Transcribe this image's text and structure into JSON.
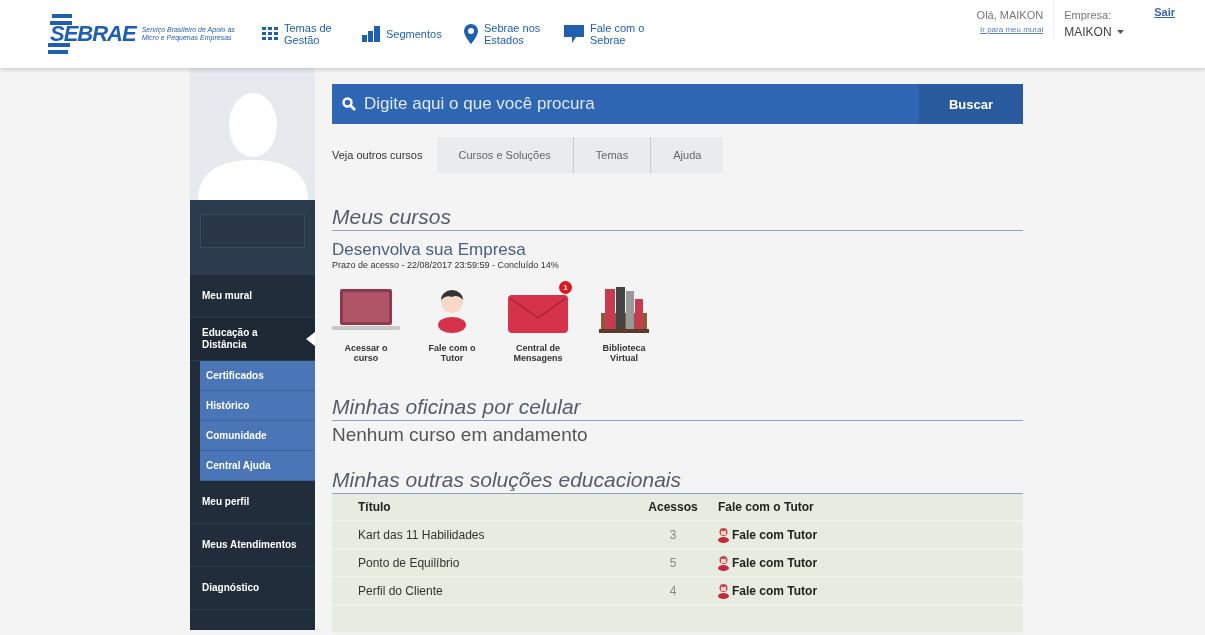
{
  "header": {
    "logo": {
      "name": "SEBRAE",
      "tagline": "Serviço Brasileiro de Apoio às Micro e Pequenas Empresas"
    },
    "nav": [
      {
        "kind": "grid",
        "label": "Temas de Gestão"
      },
      {
        "kind": "chart",
        "label": "Segmentos"
      },
      {
        "kind": "pin",
        "label": "Sebrae nos Estados"
      },
      {
        "kind": "chat",
        "label": "Fale com o Sebrae"
      }
    ],
    "user": {
      "greeting": "Olá, MAIKON",
      "link": "Ir para meu mural"
    },
    "company": {
      "label": "Empresa:",
      "value": "MAIKON"
    },
    "logout": "Sair"
  },
  "sidebar": {
    "items": [
      {
        "label": "Meu mural",
        "selected": false
      },
      {
        "label": "Educação a Distância",
        "selected": true,
        "expanded": true,
        "children": [
          {
            "label": "Certificados"
          },
          {
            "label": "Histórico"
          },
          {
            "label": "Comunidade"
          },
          {
            "label": "Central Ajuda"
          }
        ]
      },
      {
        "label": "Meu perfil",
        "selected": false
      },
      {
        "label": "Meus Atendimentos",
        "selected": false
      },
      {
        "label": "Diagnóstico",
        "selected": false
      }
    ]
  },
  "search": {
    "placeholder": "Digite aqui o que você procura",
    "button": "Buscar"
  },
  "other_courses": {
    "label": "Veja outros cursos",
    "tabs": [
      "Cursos e Soluções",
      "Temas",
      "Ajuda"
    ]
  },
  "my_courses": {
    "title": "Meus cursos",
    "course": {
      "name": "Desenvolva sua Empresa",
      "info": "Prazo de acesso - 22/08/2017 23:59:59 - Concluído 14%"
    },
    "actions": [
      {
        "kind": "laptop",
        "label": "Acessar o curso"
      },
      {
        "kind": "tutor",
        "label": "Fale com o Tutor"
      },
      {
        "kind": "mail",
        "label": "Central de Mensagens",
        "badge": "1"
      },
      {
        "kind": "books",
        "label": "Biblioteca Virtual"
      }
    ]
  },
  "mobile_workshops": {
    "title": "Minhas oficinas por celular",
    "empty": "Nenhum curso em andamento"
  },
  "other_solutions": {
    "title": "Minhas outras soluções educacionais",
    "columns": [
      "Título",
      "Acessos",
      "Fale com o Tutor"
    ],
    "rows": [
      {
        "title": "Kart das 11 Habilidades",
        "accesses": "3",
        "action": "Fale com Tutor"
      },
      {
        "title": "Ponto de Equilíbrio",
        "accesses": "5",
        "action": "Fale com Tutor"
      },
      {
        "title": "Perfil do Cliente",
        "accesses": "4",
        "action": "Fale com Tutor"
      }
    ]
  }
}
